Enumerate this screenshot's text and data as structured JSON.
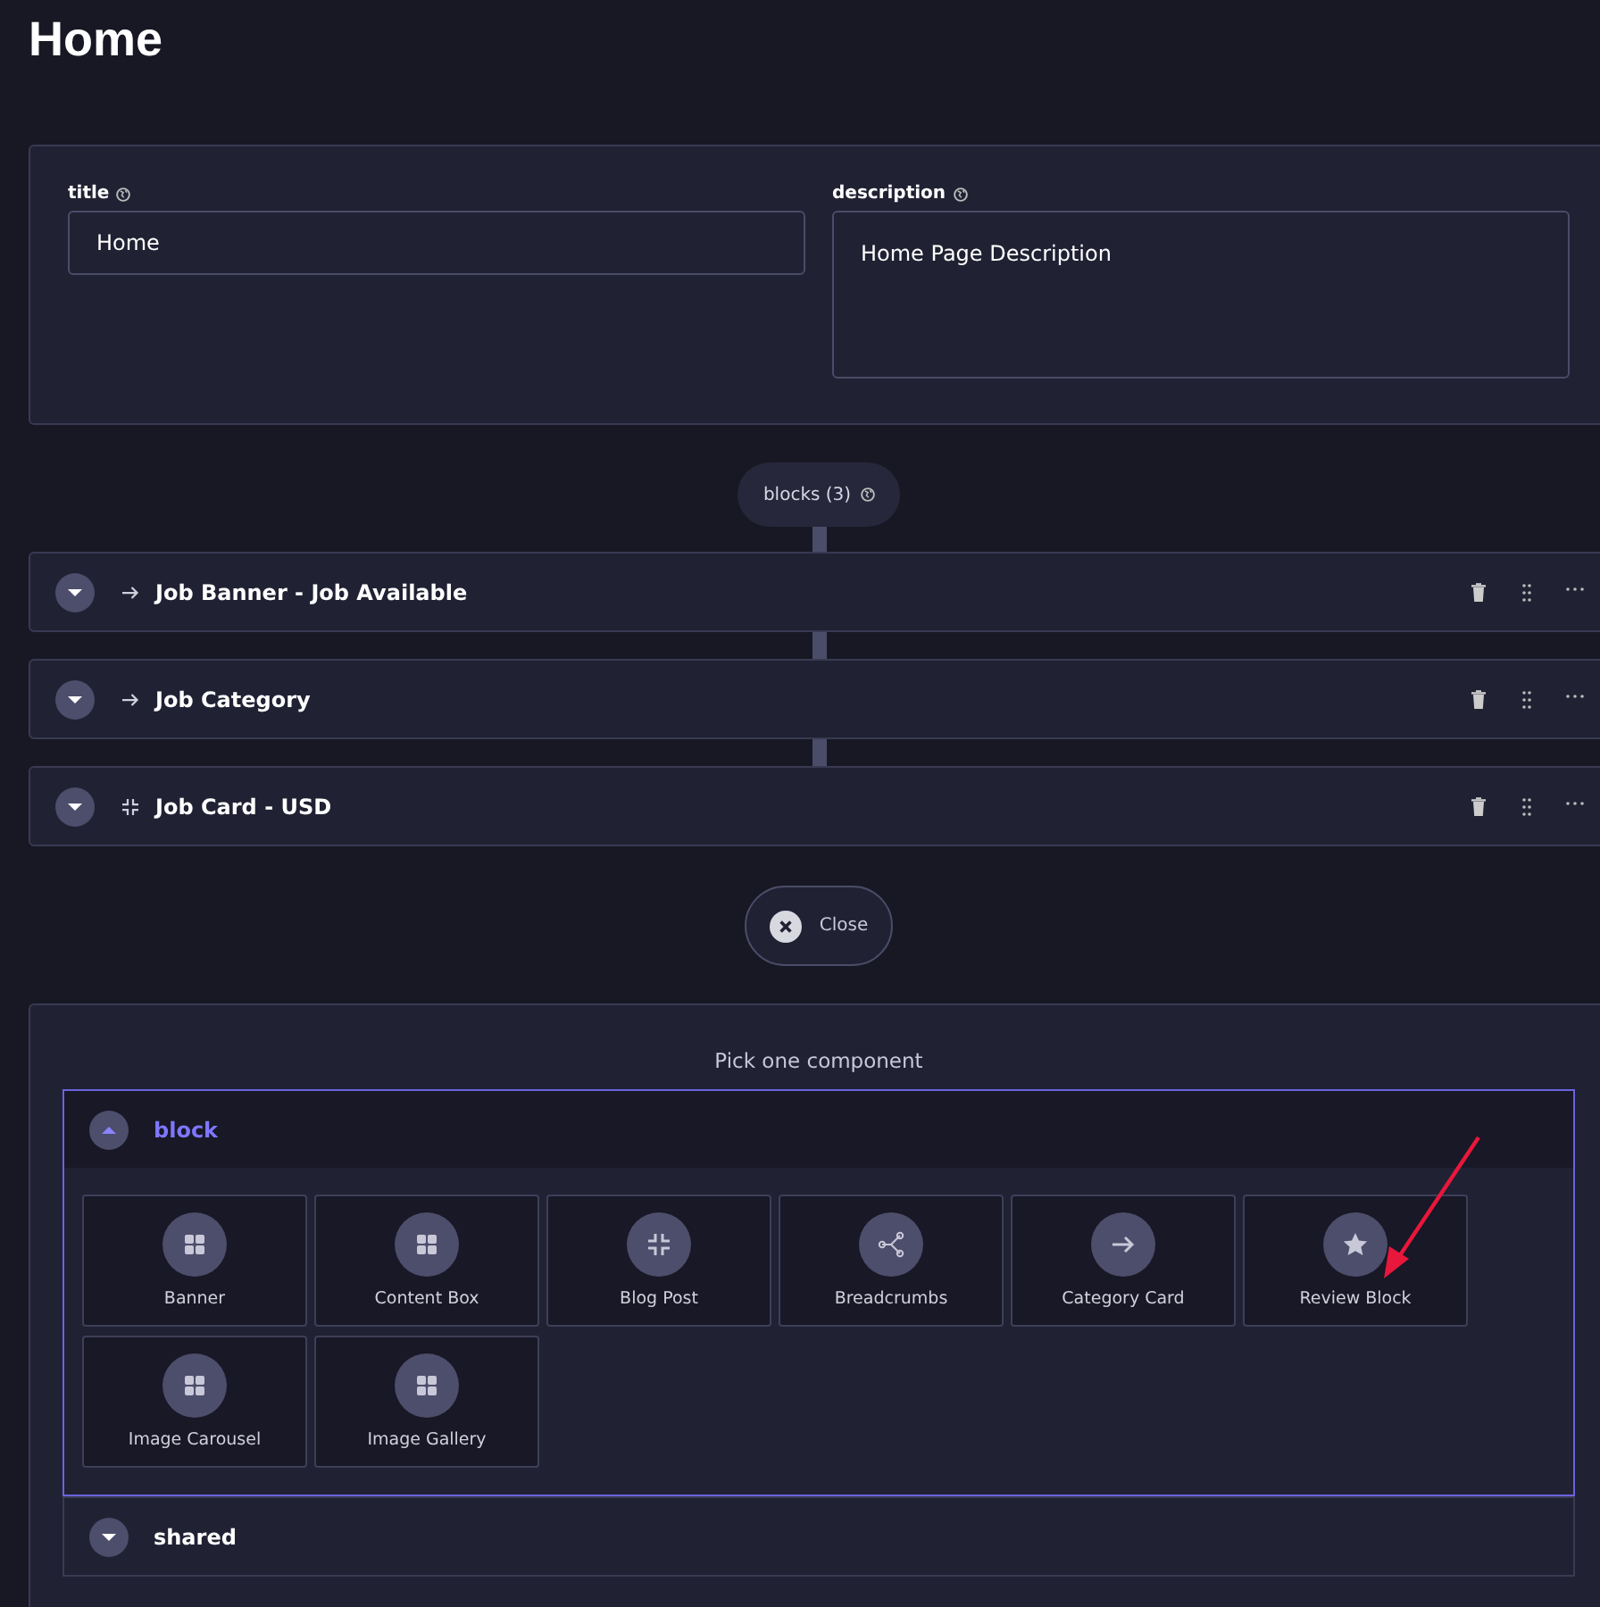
{
  "page_title": "Home",
  "fields": [
    {
      "label": "title",
      "kind": "input",
      "value": "Home"
    },
    {
      "label": "description",
      "kind": "textarea",
      "value": "Home Page Description"
    }
  ],
  "blocks_label": "blocks (3)",
  "blocks": [
    {
      "name": "Job Banner - Job Available",
      "kind": "arrow",
      "expanded": false
    },
    {
      "name": "Job Category",
      "kind": "arrow",
      "expanded": false
    },
    {
      "name": "Job Card - USD",
      "kind": "compress",
      "expanded": false
    }
  ],
  "close_button": "Close",
  "picker": {
    "title": "Pick one component",
    "groups": [
      {
        "name": "block",
        "expanded": true,
        "components": [
          {
            "label": "Banner",
            "kind": "grid"
          },
          {
            "label": "Content Box",
            "kind": "grid"
          },
          {
            "label": "Blog Post",
            "kind": "compress"
          },
          {
            "label": "Breadcrumbs",
            "kind": "share"
          },
          {
            "label": "Category Card",
            "kind": "arrow"
          },
          {
            "label": "Review Block",
            "kind": "star"
          },
          {
            "label": "Image Carousel",
            "kind": "grid"
          },
          {
            "label": "Image Gallery",
            "kind": "grid"
          }
        ]
      },
      {
        "name": "shared",
        "expanded": false
      }
    ]
  }
}
